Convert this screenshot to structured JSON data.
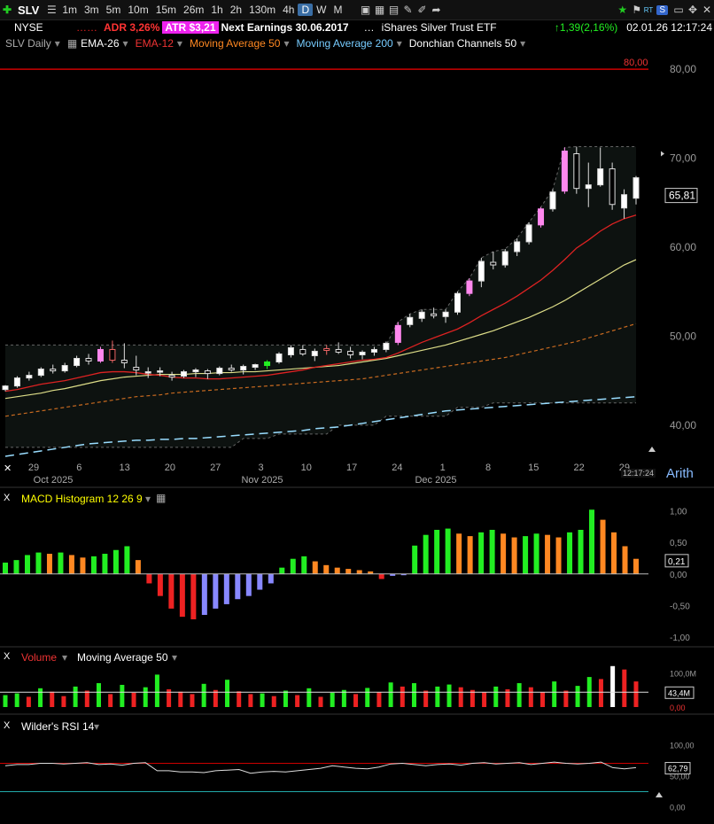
{
  "toolbar": {
    "symbol": "SLV",
    "timeframes": [
      "1m",
      "3m",
      "5m",
      "10m",
      "15m",
      "26m",
      "1h",
      "2h",
      "130m",
      "4h",
      "D",
      "W",
      "M"
    ],
    "active_timeframe": "D",
    "change": "1,39(2,16%)",
    "datetime": "02.01.26 12:17:24",
    "rt_label": "RT",
    "s_label": "S"
  },
  "info": {
    "exchange": "NYSE",
    "dots": "……",
    "adr": "ADR  3,26%",
    "atr": "ATR $3,21",
    "earnings": "Next Earnings 30.06.2017",
    "ellipsis": "…",
    "name": "iShares Silver Trust ETF"
  },
  "indicators": {
    "main": "SLV Daily",
    "ema26": "EMA-26",
    "ema12": "EMA-12",
    "ma50": "Moving Average 50",
    "ma200": "Moving Average 200",
    "donchian": "Donchian Channels 50"
  },
  "panels": {
    "macd_label": "MACD Histogram 12 26 9",
    "volume_label": "Volume",
    "volume_ma_label": "Moving Average 50",
    "rsi_label": "Wilder's RSI 14",
    "close_label": "X",
    "arith": "Arith",
    "time": "12:17:24"
  },
  "colors": {
    "up": "#ffffff",
    "down": "#000000",
    "pink": "#ff88ee",
    "green": "#22ee22",
    "red": "#ee2222",
    "orange": "#ff8822",
    "blue": "#8888ff",
    "ema26": "#ff6666",
    "ema12": "#ff3333",
    "ma50": "#dddd88",
    "ma200": "#99ddff",
    "donchian": "#888888"
  },
  "chart_data": {
    "type": "line",
    "price": {
      "ylim": [
        36,
        82
      ],
      "y_ticks": [
        "80,00",
        "70,00",
        "60,00",
        "50,00",
        "40,00"
      ],
      "y_tick_values": [
        80,
        70,
        60,
        50,
        40
      ],
      "level_line": 80,
      "level_label": "80,00",
      "last_price": "65,81",
      "last_value": 65.81,
      "x_labels": [
        "29",
        "6",
        "13",
        "20",
        "27",
        "3",
        "10",
        "17",
        "24",
        "1",
        "8",
        "15",
        "22",
        "29"
      ],
      "month_labels": [
        "Oct 2025",
        "Nov 2025",
        "Dec 2025"
      ],
      "candles": [
        [
          44.0,
          44.5,
          43.8,
          44.4
        ],
        [
          44.4,
          45.5,
          44.2,
          45.3
        ],
        [
          45.3,
          46.0,
          45.0,
          45.6
        ],
        [
          45.6,
          46.5,
          45.4,
          46.3
        ],
        [
          46.3,
          46.8,
          45.8,
          46.1
        ],
        [
          46.1,
          47.0,
          45.9,
          46.7
        ],
        [
          46.7,
          47.8,
          46.5,
          47.5
        ],
        [
          47.5,
          48.0,
          46.8,
          47.2
        ],
        [
          47.2,
          48.8,
          47.0,
          48.5
        ],
        [
          48.5,
          49.5,
          47.0,
          47.3
        ],
        [
          47.3,
          49.2,
          46.4,
          47.0
        ],
        [
          46.5,
          47.8,
          45.6,
          46.2
        ],
        [
          46.0,
          46.5,
          45.3,
          46.0
        ],
        [
          46.1,
          46.5,
          45.5,
          46.1
        ],
        [
          45.6,
          46.0,
          45.0,
          45.4
        ],
        [
          45.5,
          46.2,
          45.3,
          46.0
        ],
        [
          46.0,
          46.4,
          45.4,
          46.2
        ],
        [
          46.1,
          46.3,
          45.2,
          45.8
        ],
        [
          45.8,
          46.6,
          45.6,
          46.4
        ],
        [
          46.4,
          46.8,
          46.0,
          46.2
        ],
        [
          46.2,
          46.8,
          45.7,
          46.6
        ],
        [
          46.5,
          46.9,
          46.2,
          46.8
        ],
        [
          46.7,
          47.3,
          46.3,
          47.1
        ],
        [
          47.1,
          48.2,
          46.9,
          48.0
        ],
        [
          47.9,
          49.0,
          47.6,
          48.7
        ],
        [
          48.5,
          49.0,
          47.8,
          48.0
        ],
        [
          47.8,
          48.6,
          47.2,
          48.3
        ],
        [
          48.4,
          49.0,
          47.9,
          48.6
        ],
        [
          48.5,
          49.3,
          48.0,
          48.2
        ],
        [
          48.3,
          48.8,
          47.5,
          47.9
        ],
        [
          47.9,
          48.4,
          47.4,
          48.2
        ],
        [
          48.2,
          48.8,
          47.8,
          48.5
        ],
        [
          48.5,
          49.4,
          48.2,
          49.2
        ],
        [
          49.3,
          51.6,
          49.0,
          51.2
        ],
        [
          51.3,
          52.5,
          51.0,
          52.1
        ],
        [
          52.0,
          53.0,
          51.6,
          52.7
        ],
        [
          52.5,
          53.2,
          52.0,
          52.3
        ],
        [
          52.2,
          53.0,
          51.5,
          52.7
        ],
        [
          52.7,
          55.0,
          52.4,
          54.8
        ],
        [
          54.8,
          56.5,
          54.5,
          56.2
        ],
        [
          56.2,
          58.8,
          55.5,
          58.4
        ],
        [
          58.3,
          59.5,
          57.5,
          58.0
        ],
        [
          58.0,
          59.8,
          57.7,
          59.5
        ],
        [
          59.5,
          61.0,
          59.0,
          60.6
        ],
        [
          60.6,
          62.8,
          60.3,
          62.5
        ],
        [
          62.5,
          64.5,
          62.2,
          64.3
        ],
        [
          64.3,
          66.5,
          64.0,
          66.2
        ],
        [
          66.3,
          71.2,
          66.0,
          70.8
        ],
        [
          70.5,
          71.3,
          66.0,
          66.6
        ],
        [
          66.6,
          69.5,
          64.5,
          67.0
        ],
        [
          67.0,
          71.2,
          66.8,
          68.8
        ],
        [
          68.8,
          69.5,
          64.2,
          64.8
        ],
        [
          64.4,
          66.5,
          63.2,
          65.9
        ],
        [
          65.5,
          68.0,
          64.8,
          67.8
        ]
      ],
      "ema12": [
        43.8,
        44.0,
        44.3,
        44.6,
        44.8,
        45.0,
        45.3,
        45.6,
        45.9,
        46.0,
        46.0,
        45.9,
        45.7,
        45.6,
        45.4,
        45.3,
        45.3,
        45.2,
        45.2,
        45.3,
        45.4,
        45.5,
        45.6,
        45.8,
        46.0,
        46.2,
        46.5,
        46.7,
        46.9,
        47.1,
        47.3,
        47.4,
        47.6,
        48.1,
        48.7,
        49.3,
        49.8,
        50.3,
        50.8,
        51.5,
        52.3,
        53.0,
        53.7,
        54.5,
        55.4,
        56.3,
        57.4,
        58.6,
        59.9,
        60.8,
        61.8,
        62.6,
        63.2,
        63.6
      ],
      "ma50": [
        43.0,
        43.2,
        43.4,
        43.6,
        43.9,
        44.1,
        44.4,
        44.7,
        45.0,
        45.2,
        45.4,
        45.5,
        45.6,
        45.7,
        45.7,
        45.7,
        45.8,
        45.8,
        45.9,
        45.9,
        46.0,
        46.0,
        46.1,
        46.2,
        46.3,
        46.4,
        46.5,
        46.6,
        46.7,
        46.9,
        47.1,
        47.3,
        47.5,
        47.8,
        48.1,
        48.4,
        48.7,
        49.0,
        49.4,
        49.8,
        50.2,
        50.6,
        51.1,
        51.6,
        52.1,
        52.7,
        53.3,
        54.0,
        54.8,
        55.6,
        56.4,
        57.2,
        58.0,
        58.6
      ],
      "ma200": [
        41.0,
        41.2,
        41.4,
        41.6,
        41.8,
        42.0,
        42.2,
        42.4,
        42.6,
        42.8,
        43.0,
        43.2,
        43.3,
        43.4,
        43.6,
        43.7,
        43.8,
        43.9,
        44.0,
        44.1,
        44.2,
        44.3,
        44.4,
        44.5,
        44.6,
        44.7,
        44.8,
        44.9,
        45.0,
        45.1,
        45.2,
        45.4,
        45.6,
        45.8,
        46.0,
        46.2,
        46.4,
        46.6,
        46.8,
        47.0,
        47.2,
        47.4,
        47.6,
        47.9,
        48.2,
        48.5,
        48.8,
        49.1,
        49.4,
        49.8,
        50.2,
        50.6,
        51.0,
        51.4
      ],
      "ema26": [
        36.5,
        36.7,
        36.9,
        37.1,
        37.3,
        37.5,
        37.7,
        37.9,
        38.0,
        38.1,
        38.2,
        38.3,
        38.3,
        38.4,
        38.4,
        38.5,
        38.5,
        38.6,
        38.7,
        38.8,
        38.9,
        39.0,
        39.1,
        39.2,
        39.3,
        39.4,
        39.6,
        39.7,
        39.8,
        40.0,
        40.2,
        40.4,
        40.6,
        40.8,
        41.0,
        41.2,
        41.4,
        41.6,
        41.7,
        41.8,
        41.9,
        42.0,
        42.1,
        42.2,
        42.3,
        42.4,
        42.5,
        42.6,
        42.7,
        42.8,
        42.9,
        43.0,
        43.1,
        43.2
      ],
      "donchian_high": [
        49,
        49,
        49,
        49,
        49,
        49,
        49,
        49,
        49,
        49,
        49,
        49,
        49,
        49,
        49,
        49,
        49,
        49,
        49,
        49,
        49,
        49,
        49,
        49,
        49,
        49,
        49,
        49,
        49,
        49,
        49,
        49,
        49,
        51.6,
        52.5,
        53,
        53,
        53,
        55,
        56.5,
        58.8,
        59.5,
        59.8,
        61,
        62.8,
        64.5,
        66.5,
        71.2,
        71.3,
        71.3,
        71.3,
        71.3,
        71.3,
        71.3
      ],
      "donchian_low": [
        37.5,
        37.5,
        37.5,
        37.5,
        37.5,
        37.5,
        37.5,
        37.5,
        37.5,
        37.5,
        37.5,
        37.5,
        37.5,
        37.5,
        37.5,
        37.5,
        37.5,
        37.5,
        37.5,
        37.5,
        38.5,
        38.5,
        38.5,
        39.0,
        39.0,
        39.0,
        39.0,
        39.0,
        40.0,
        40.0,
        40.0,
        40.0,
        41.0,
        41.0,
        41.0,
        41.0,
        41.0,
        41.0,
        42.0,
        42.0,
        42.0,
        42.5,
        42.5,
        42.5,
        42.5,
        42.5,
        42.5,
        42.5,
        42.5,
        42.5,
        42.5,
        42.5,
        42.5,
        42.5
      ]
    },
    "macd": {
      "ylim": [
        -1.1,
        1.15
      ],
      "y_ticks": [
        "1,00",
        "0,50",
        "0,00",
        "-0,50",
        "-1,00"
      ],
      "y_tick_values": [
        1.0,
        0.5,
        0.0,
        -0.5,
        -1.0
      ],
      "last_label": "0,21",
      "values": [
        0.18,
        0.22,
        0.3,
        0.34,
        0.32,
        0.34,
        0.3,
        0.26,
        0.28,
        0.32,
        0.38,
        0.44,
        0.22,
        -0.15,
        -0.35,
        -0.55,
        -0.68,
        -0.72,
        -0.65,
        -0.55,
        -0.48,
        -0.4,
        -0.35,
        -0.25,
        -0.15,
        0.1,
        0.24,
        0.28,
        0.2,
        0.14,
        0.1,
        0.08,
        0.06,
        0.04,
        -0.08,
        -0.03,
        -0.02,
        0.45,
        0.62,
        0.7,
        0.72,
        0.64,
        0.6,
        0.66,
        0.7,
        0.64,
        0.58,
        0.6,
        0.64,
        0.62,
        0.58,
        0.66,
        0.7,
        1.02,
        0.86,
        0.66,
        0.44,
        0.24
      ]
    },
    "volume": {
      "y_ticks": [
        "100,0M",
        "0,00"
      ],
      "y_tick_values": [
        100,
        0
      ],
      "ylim": [
        0,
        135
      ],
      "ma_value": 43.4,
      "last_label": "43,4M",
      "values": [
        35,
        40,
        30,
        55,
        45,
        32,
        60,
        48,
        70,
        38,
        65,
        42,
        58,
        95,
        52,
        45,
        38,
        68,
        50,
        80,
        46,
        38,
        40,
        32,
        48,
        35,
        55,
        30,
        42,
        50,
        38,
        56,
        44,
        72,
        60,
        70,
        48,
        60,
        66,
        58,
        50,
        44,
        60,
        52,
        70,
        58,
        44,
        75,
        48,
        62,
        88,
        82,
        120,
        110,
        75
      ]
    },
    "rsi": {
      "y_ticks": [
        "100,00",
        "50,00",
        "0,00"
      ],
      "y_tick_values": [
        100,
        50,
        0
      ],
      "ylim": [
        -5,
        115
      ],
      "levels": [
        70,
        30
      ],
      "last_label": "62,79",
      "values": [
        66,
        68,
        68,
        70,
        70,
        69,
        70,
        71,
        68,
        69,
        67,
        70,
        71,
        58,
        58,
        56,
        56,
        55,
        58,
        59,
        60,
        54,
        56,
        57,
        56,
        58,
        60,
        62,
        66,
        64,
        62,
        61,
        64,
        69,
        70,
        68,
        66,
        68,
        69,
        67,
        70,
        71,
        69,
        70,
        71,
        68,
        70,
        72,
        70,
        69,
        70,
        72,
        63,
        61,
        63
      ]
    }
  }
}
